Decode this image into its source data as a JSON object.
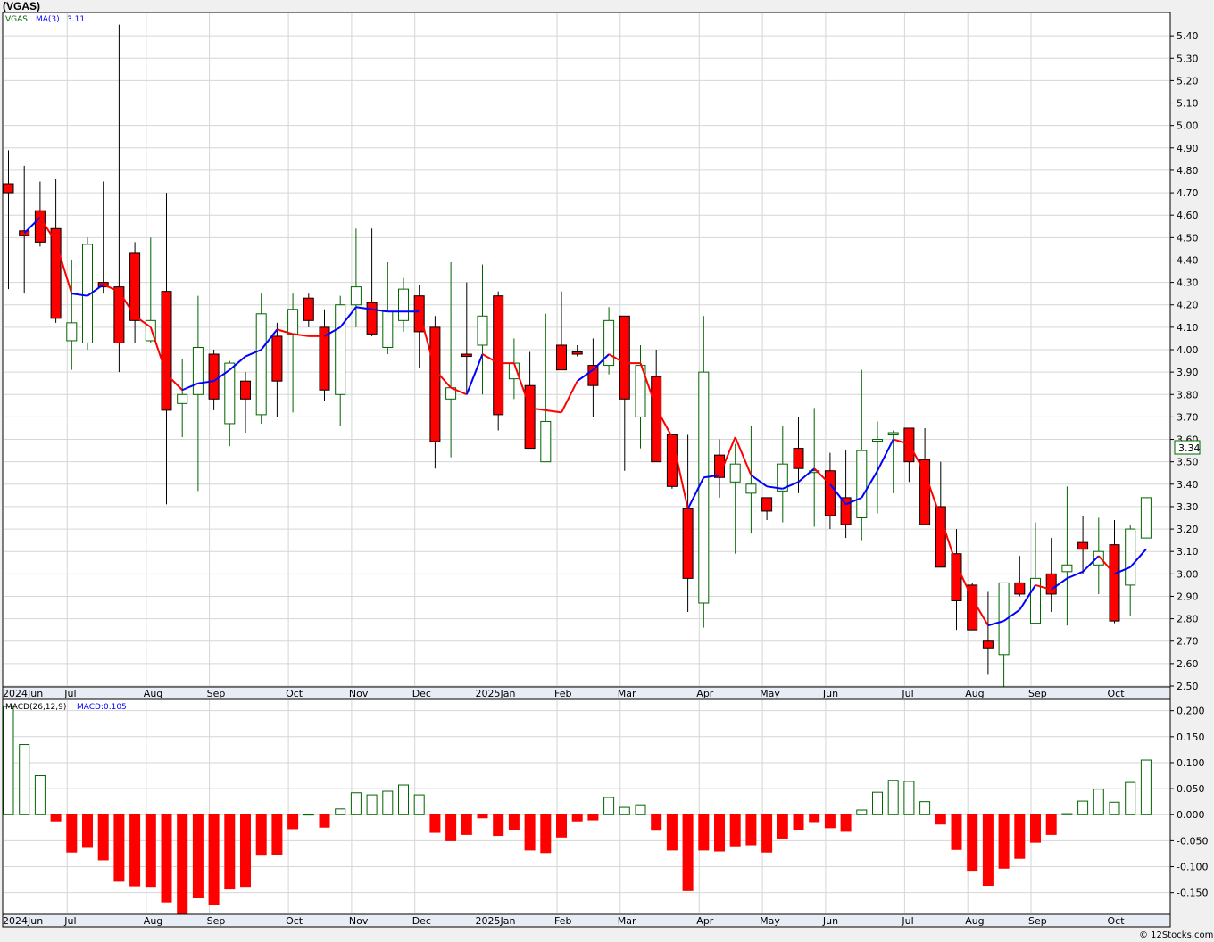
{
  "chart_data": {
    "title": "(VGAS)",
    "credit": "© 12Stocks.com",
    "type": "candlestick",
    "colors": {
      "up": "#006400",
      "down": "#ff0000",
      "ma_up": "#0000ff",
      "ma_down": "#ff0000",
      "macd_up": "#006400",
      "macd_down": "#ff0000",
      "grid": "#d6d6d6"
    },
    "price_panel": {
      "legend_symbol": "VGAS",
      "legend_ma": "MA(3)",
      "legend_ma_value": "3.11",
      "last_price_label": "3.34",
      "ylim": [
        2.5,
        5.5
      ],
      "ticks": [
        2.5,
        2.6,
        2.7,
        2.8,
        2.9,
        3.0,
        3.1,
        3.2,
        3.3,
        3.4,
        3.5,
        3.6,
        3.7,
        3.8,
        3.9,
        4.0,
        4.1,
        4.2,
        4.3,
        4.4,
        4.5,
        4.6,
        4.7,
        4.8,
        4.9,
        5.0,
        5.1,
        5.2,
        5.3,
        5.4
      ],
      "tick_labels": [
        "2.50",
        "2.60",
        "2.70",
        "2.80",
        "2.90",
        "3.00",
        "3.10",
        "3.20",
        "3.30",
        "3.40",
        "3.50",
        "3.60",
        "3.70",
        "3.80",
        "3.90",
        "4.00",
        "4.10",
        "4.20",
        "4.30",
        "4.40",
        "4.50",
        "4.60",
        "4.70",
        "4.80",
        "4.90",
        "5.00",
        "5.10",
        "5.20",
        "5.30",
        "5.40"
      ],
      "candles": [
        {
          "o": 4.74,
          "h": 4.89,
          "l": 4.27,
          "c": 4.7
        },
        {
          "o": 4.53,
          "h": 4.82,
          "l": 4.25,
          "c": 4.51
        },
        {
          "o": 4.62,
          "h": 4.75,
          "l": 4.46,
          "c": 4.48
        },
        {
          "o": 4.54,
          "h": 4.76,
          "l": 4.12,
          "c": 4.14
        },
        {
          "o": 4.04,
          "h": 4.4,
          "l": 3.91,
          "c": 4.12
        },
        {
          "o": 4.03,
          "h": 4.5,
          "l": 4.0,
          "c": 4.47
        },
        {
          "o": 4.3,
          "h": 4.75,
          "l": 4.25,
          "c": 4.28
        },
        {
          "o": 4.28,
          "h": 5.45,
          "l": 3.9,
          "c": 4.03
        },
        {
          "o": 4.43,
          "h": 4.48,
          "l": 4.03,
          "c": 4.13
        },
        {
          "o": 4.04,
          "h": 4.5,
          "l": 4.03,
          "c": 4.13
        },
        {
          "o": 4.26,
          "h": 4.7,
          "l": 3.31,
          "c": 3.73
        },
        {
          "o": 3.76,
          "h": 3.96,
          "l": 3.61,
          "c": 3.8
        },
        {
          "o": 3.8,
          "h": 4.24,
          "l": 3.37,
          "c": 4.01
        },
        {
          "o": 3.98,
          "h": 4.0,
          "l": 3.73,
          "c": 3.78
        },
        {
          "o": 3.67,
          "h": 3.95,
          "l": 3.57,
          "c": 3.94
        },
        {
          "o": 3.86,
          "h": 3.9,
          "l": 3.63,
          "c": 3.78
        },
        {
          "o": 3.71,
          "h": 4.25,
          "l": 3.67,
          "c": 4.16
        },
        {
          "o": 4.06,
          "h": 4.12,
          "l": 3.7,
          "c": 3.86
        },
        {
          "o": 4.07,
          "h": 4.25,
          "l": 3.72,
          "c": 4.18
        },
        {
          "o": 4.23,
          "h": 4.25,
          "l": 4.1,
          "c": 4.13
        },
        {
          "o": 4.1,
          "h": 4.18,
          "l": 3.77,
          "c": 3.82
        },
        {
          "o": 3.8,
          "h": 4.24,
          "l": 3.66,
          "c": 4.2
        },
        {
          "o": 4.2,
          "h": 4.54,
          "l": 4.1,
          "c": 4.28
        },
        {
          "o": 4.21,
          "h": 4.54,
          "l": 4.06,
          "c": 4.07
        },
        {
          "o": 4.01,
          "h": 4.39,
          "l": 3.98,
          "c": 4.17
        },
        {
          "o": 4.13,
          "h": 4.32,
          "l": 4.08,
          "c": 4.27
        },
        {
          "o": 4.24,
          "h": 4.29,
          "l": 3.92,
          "c": 4.08
        },
        {
          "o": 4.1,
          "h": 4.15,
          "l": 3.47,
          "c": 3.59
        },
        {
          "o": 3.78,
          "h": 4.39,
          "l": 3.52,
          "c": 3.83
        },
        {
          "o": 3.98,
          "h": 4.3,
          "l": 3.8,
          "c": 3.97
        },
        {
          "o": 4.02,
          "h": 4.38,
          "l": 3.8,
          "c": 4.15
        },
        {
          "o": 4.24,
          "h": 4.26,
          "l": 3.64,
          "c": 3.71
        },
        {
          "o": 3.87,
          "h": 4.05,
          "l": 3.78,
          "c": 3.94
        },
        {
          "o": 3.84,
          "h": 3.99,
          "l": 3.56,
          "c": 3.56
        },
        {
          "o": 3.5,
          "h": 4.16,
          "l": 3.5,
          "c": 3.68
        },
        {
          "o": 4.02,
          "h": 4.26,
          "l": 3.91,
          "c": 3.91
        },
        {
          "o": 3.99,
          "h": 4.02,
          "l": 3.97,
          "c": 3.98
        },
        {
          "o": 3.93,
          "h": 4.05,
          "l": 3.7,
          "c": 3.84
        },
        {
          "o": 3.93,
          "h": 4.19,
          "l": 3.89,
          "c": 4.13
        },
        {
          "o": 4.15,
          "h": 4.15,
          "l": 3.46,
          "c": 3.78
        },
        {
          "o": 3.7,
          "h": 4.02,
          "l": 3.56,
          "c": 3.93
        },
        {
          "o": 3.88,
          "h": 4.0,
          "l": 3.5,
          "c": 3.5
        },
        {
          "o": 3.62,
          "h": 3.62,
          "l": 3.38,
          "c": 3.39
        },
        {
          "o": 3.29,
          "h": 3.62,
          "l": 2.83,
          "c": 2.98
        },
        {
          "o": 2.87,
          "h": 4.15,
          "l": 2.76,
          "c": 3.9
        },
        {
          "o": 3.53,
          "h": 3.6,
          "l": 3.34,
          "c": 3.43
        },
        {
          "o": 3.41,
          "h": 3.58,
          "l": 3.09,
          "c": 3.49
        },
        {
          "o": 3.36,
          "h": 3.66,
          "l": 3.18,
          "c": 3.4
        },
        {
          "o": 3.34,
          "h": 3.34,
          "l": 3.24,
          "c": 3.28
        },
        {
          "o": 3.37,
          "h": 3.66,
          "l": 3.23,
          "c": 3.49
        },
        {
          "o": 3.56,
          "h": 3.7,
          "l": 3.36,
          "c": 3.47
        },
        {
          "o": 3.46,
          "h": 3.74,
          "l": 3.21,
          "c": 3.46
        },
        {
          "o": 3.46,
          "h": 3.54,
          "l": 3.2,
          "c": 3.26
        },
        {
          "o": 3.34,
          "h": 3.55,
          "l": 3.16,
          "c": 3.22
        },
        {
          "o": 3.25,
          "h": 3.91,
          "l": 3.15,
          "c": 3.55
        },
        {
          "o": 3.6,
          "h": 3.68,
          "l": 3.27,
          "c": 3.6
        },
        {
          "o": 3.62,
          "h": 3.64,
          "l": 3.36,
          "c": 3.63
        },
        {
          "o": 3.65,
          "h": 3.65,
          "l": 3.41,
          "c": 3.5
        },
        {
          "o": 3.51,
          "h": 3.65,
          "l": 3.22,
          "c": 3.22
        },
        {
          "o": 3.3,
          "h": 3.5,
          "l": 3.03,
          "c": 3.03
        },
        {
          "o": 3.09,
          "h": 3.2,
          "l": 2.75,
          "c": 2.88
        },
        {
          "o": 2.95,
          "h": 2.96,
          "l": 2.75,
          "c": 2.75
        },
        {
          "o": 2.7,
          "h": 2.92,
          "l": 2.55,
          "c": 2.67
        },
        {
          "o": 2.64,
          "h": 2.96,
          "l": 2.48,
          "c": 2.96
        },
        {
          "o": 2.96,
          "h": 3.08,
          "l": 2.9,
          "c": 2.91
        },
        {
          "o": 2.78,
          "h": 3.23,
          "l": 2.78,
          "c": 2.98
        },
        {
          "o": 3.0,
          "h": 3.16,
          "l": 2.83,
          "c": 2.91
        },
        {
          "o": 3.01,
          "h": 3.39,
          "l": 2.77,
          "c": 3.04
        },
        {
          "o": 3.14,
          "h": 3.26,
          "l": 3.0,
          "c": 3.11
        },
        {
          "o": 3.04,
          "h": 3.25,
          "l": 2.91,
          "c": 3.1
        },
        {
          "o": 3.13,
          "h": 3.24,
          "l": 2.78,
          "c": 2.79
        },
        {
          "o": 2.95,
          "h": 3.22,
          "l": 2.81,
          "c": 3.2
        },
        {
          "o": 3.16,
          "h": 3.34,
          "l": 3.16,
          "c": 3.34
        }
      ],
      "ma": [
        null,
        4.52,
        4.59,
        4.48,
        4.25,
        4.24,
        4.29,
        4.26,
        4.15,
        4.1,
        3.89,
        3.82,
        3.85,
        3.86,
        3.91,
        3.97,
        4.0,
        4.09,
        4.07,
        4.06,
        4.06,
        4.1,
        4.19,
        4.18,
        4.17,
        4.17,
        4.17,
        3.91,
        3.83,
        3.8,
        3.98,
        3.94,
        3.94,
        3.74,
        3.73,
        3.72,
        3.86,
        3.91,
        3.98,
        3.94,
        3.94,
        3.74,
        3.61,
        3.29,
        3.43,
        3.44,
        3.61,
        3.44,
        3.39,
        3.38,
        3.41,
        3.47,
        3.4,
        3.31,
        3.34,
        3.46,
        3.6,
        3.58,
        3.45,
        3.25,
        3.04,
        2.89,
        2.77,
        2.79,
        2.84,
        2.95,
        2.93,
        2.98,
        3.01,
        3.08,
        3.0,
        3.03,
        3.11
      ],
      "ma_down_flags": [
        false,
        false,
        false,
        true,
        true,
        false,
        false,
        true,
        true,
        true,
        true,
        true,
        false,
        false,
        false,
        false,
        false,
        false,
        true,
        true,
        true,
        false,
        false,
        false,
        false,
        false,
        false,
        true,
        true,
        true,
        false,
        true,
        true,
        true,
        true,
        true,
        true,
        false,
        false,
        true,
        true,
        true,
        true,
        true,
        false,
        false,
        true,
        true,
        false,
        false,
        false,
        false,
        true,
        false,
        false,
        false,
        false,
        true,
        true,
        true,
        true,
        true,
        true,
        false,
        false,
        false,
        true,
        false,
        false,
        false,
        true,
        false,
        false
      ]
    },
    "macd_panel": {
      "label": "MACD(26,12,9)",
      "value_label": "MACD:0.105",
      "ylim": [
        -0.19,
        0.22
      ],
      "ticks": [
        -0.15,
        -0.1,
        -0.05,
        0.0,
        0.05,
        0.1,
        0.15,
        0.2
      ],
      "tick_labels": [
        "-0.150",
        "-0.100",
        "-0.050",
        "0.000",
        "0.050",
        "0.100",
        "0.150",
        "0.200"
      ],
      "values": [
        0.208,
        0.135,
        0.075,
        -0.012,
        -0.072,
        -0.063,
        -0.087,
        -0.128,
        -0.137,
        -0.138,
        -0.168,
        -0.197,
        -0.16,
        -0.172,
        -0.143,
        -0.138,
        -0.078,
        -0.077,
        -0.027,
        0.001,
        -0.024,
        0.011,
        0.042,
        0.038,
        0.045,
        0.057,
        0.038,
        -0.034,
        -0.05,
        -0.038,
        -0.006,
        -0.04,
        -0.028,
        -0.068,
        -0.073,
        -0.043,
        -0.012,
        -0.01,
        0.033,
        0.014,
        0.019,
        -0.03,
        -0.068,
        -0.146,
        -0.068,
        -0.07,
        -0.06,
        -0.058,
        -0.072,
        -0.045,
        -0.029,
        -0.015,
        -0.025,
        -0.032,
        0.009,
        0.043,
        0.066,
        0.064,
        0.025,
        -0.018,
        -0.067,
        -0.107,
        -0.136,
        -0.103,
        -0.084,
        -0.053,
        -0.038,
        0.002,
        0.026,
        0.049,
        0.024,
        0.062,
        0.105
      ]
    },
    "month_labels": [
      "2024Jun",
      "Jul",
      "Aug",
      "Sep",
      "Oct",
      "Nov",
      "Dec",
      "2025Jan",
      "Feb",
      "Mar",
      "Apr",
      "May",
      "Jun",
      "Jul",
      "Aug",
      "Sep",
      "Oct"
    ],
    "month_starts": [
      0,
      4,
      9,
      13,
      18,
      22,
      26,
      30,
      35,
      39,
      44,
      48,
      52,
      57,
      61,
      65,
      70
    ]
  }
}
